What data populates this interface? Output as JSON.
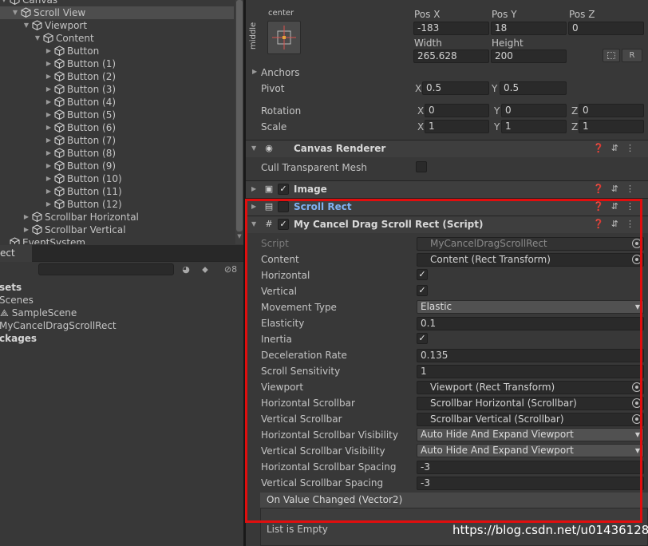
{
  "hierarchy": {
    "rows": [
      {
        "label": "Canvas",
        "indent": 0,
        "arrow": "▼",
        "selected": false
      },
      {
        "label": "Scroll View",
        "indent": 1,
        "arrow": "▼",
        "selected": true
      },
      {
        "label": "Viewport",
        "indent": 2,
        "arrow": "▼",
        "selected": false
      },
      {
        "label": "Content",
        "indent": 3,
        "arrow": "▼",
        "selected": false
      },
      {
        "label": "Button",
        "indent": 4,
        "arrow": "▶",
        "selected": false
      },
      {
        "label": "Button (1)",
        "indent": 4,
        "arrow": "▶",
        "selected": false
      },
      {
        "label": "Button (2)",
        "indent": 4,
        "arrow": "▶",
        "selected": false
      },
      {
        "label": "Button (3)",
        "indent": 4,
        "arrow": "▶",
        "selected": false
      },
      {
        "label": "Button (4)",
        "indent": 4,
        "arrow": "▶",
        "selected": false
      },
      {
        "label": "Button (5)",
        "indent": 4,
        "arrow": "▶",
        "selected": false
      },
      {
        "label": "Button (6)",
        "indent": 4,
        "arrow": "▶",
        "selected": false
      },
      {
        "label": "Button (7)",
        "indent": 4,
        "arrow": "▶",
        "selected": false
      },
      {
        "label": "Button (8)",
        "indent": 4,
        "arrow": "▶",
        "selected": false
      },
      {
        "label": "Button (9)",
        "indent": 4,
        "arrow": "▶",
        "selected": false
      },
      {
        "label": "Button (10)",
        "indent": 4,
        "arrow": "▶",
        "selected": false
      },
      {
        "label": "Button (11)",
        "indent": 4,
        "arrow": "▶",
        "selected": false
      },
      {
        "label": "Button (12)",
        "indent": 4,
        "arrow": "▶",
        "selected": false
      },
      {
        "label": "Scrollbar Horizontal",
        "indent": 2,
        "arrow": "▶",
        "selected": false
      },
      {
        "label": "Scrollbar Vertical",
        "indent": 2,
        "arrow": "▶",
        "selected": false
      },
      {
        "label": "EventSystem",
        "indent": 0,
        "arrow": "",
        "selected": false
      }
    ]
  },
  "project": {
    "tab_label": "ect",
    "hidden_count": "8",
    "rows": [
      {
        "label": "sets",
        "bold": true,
        "indent": 0,
        "icon": ""
      },
      {
        "label": "Scenes",
        "bold": false,
        "indent": 0,
        "icon": ""
      },
      {
        "label": "SampleScene",
        "bold": false,
        "indent": 1,
        "icon": "unity-scene-icon"
      },
      {
        "label": "MyCancelDragScrollRect",
        "bold": false,
        "indent": 0,
        "icon": ""
      },
      {
        "label": "ckages",
        "bold": true,
        "indent": 0,
        "icon": ""
      }
    ]
  },
  "rect_transform": {
    "anchor_top_label": "center",
    "anchor_side_label": "middle",
    "pos_x_label": "Pos X",
    "pos_x": "-183",
    "pos_y_label": "Pos Y",
    "pos_y": "18",
    "pos_z_label": "Pos Z",
    "pos_z": "0",
    "width_label": "Width",
    "width": "265.628",
    "height_label": "Height",
    "height": "200",
    "r_button": "R",
    "anchors_label": "Anchors",
    "pivot_label": "Pivot",
    "pivot_x": "0.5",
    "pivot_y": "0.5",
    "rotation_label": "Rotation",
    "rot_x": "0",
    "rot_y": "0",
    "rot_z": "0",
    "scale_label": "Scale",
    "scale_x": "1",
    "scale_y": "1",
    "scale_z": "1",
    "axis_x": "X",
    "axis_y": "Y",
    "axis_z": "Z"
  },
  "components": {
    "canvas_renderer": {
      "name": "Canvas Renderer",
      "cull_label": "Cull Transparent Mesh"
    },
    "image": {
      "name": "Image"
    },
    "scroll_rect": {
      "name": "Scroll Rect"
    },
    "my_script": {
      "name": "My Cancel Drag Scroll Rect (Script)"
    }
  },
  "script_props": {
    "script_label": "Script",
    "script_value": "MyCancelDragScrollRect",
    "content_label": "Content",
    "content_value": "Content (Rect Transform)",
    "horizontal_label": "Horizontal",
    "vertical_label": "Vertical",
    "movement_label": "Movement Type",
    "movement_value": "Elastic",
    "elasticity_label": "Elasticity",
    "elasticity_value": "0.1",
    "inertia_label": "Inertia",
    "decel_label": "Deceleration Rate",
    "decel_value": "0.135",
    "sensitivity_label": "Scroll Sensitivity",
    "sensitivity_value": "1",
    "viewport_label": "Viewport",
    "viewport_value": "Viewport (Rect Transform)",
    "hscroll_label": "Horizontal Scrollbar",
    "hscroll_value": "Scrollbar Horizontal (Scrollbar)",
    "vscroll_label": "Vertical Scrollbar",
    "vscroll_value": "Scrollbar Vertical (Scrollbar)",
    "hvis_label": "Horizontal Scrollbar Visibility",
    "hvis_value": "Auto Hide And Expand Viewport",
    "vvis_label": "Vertical Scrollbar Visibility",
    "vvis_value": "Auto Hide And Expand Viewport",
    "hspace_label": "Horizontal Scrollbar Spacing",
    "hspace_value": "-3",
    "vspace_label": "Vertical Scrollbar Spacing",
    "vspace_value": "-3",
    "event_label": "On Value Changed (Vector2)",
    "list_empty": "List is Empty"
  },
  "watermark": "https://blog.csdn.net/u014361280",
  "colors": {
    "highlight_box": "#e10e0e",
    "scroll_rect_name": "#7fb0f0",
    "panel_bg": "#383838"
  }
}
